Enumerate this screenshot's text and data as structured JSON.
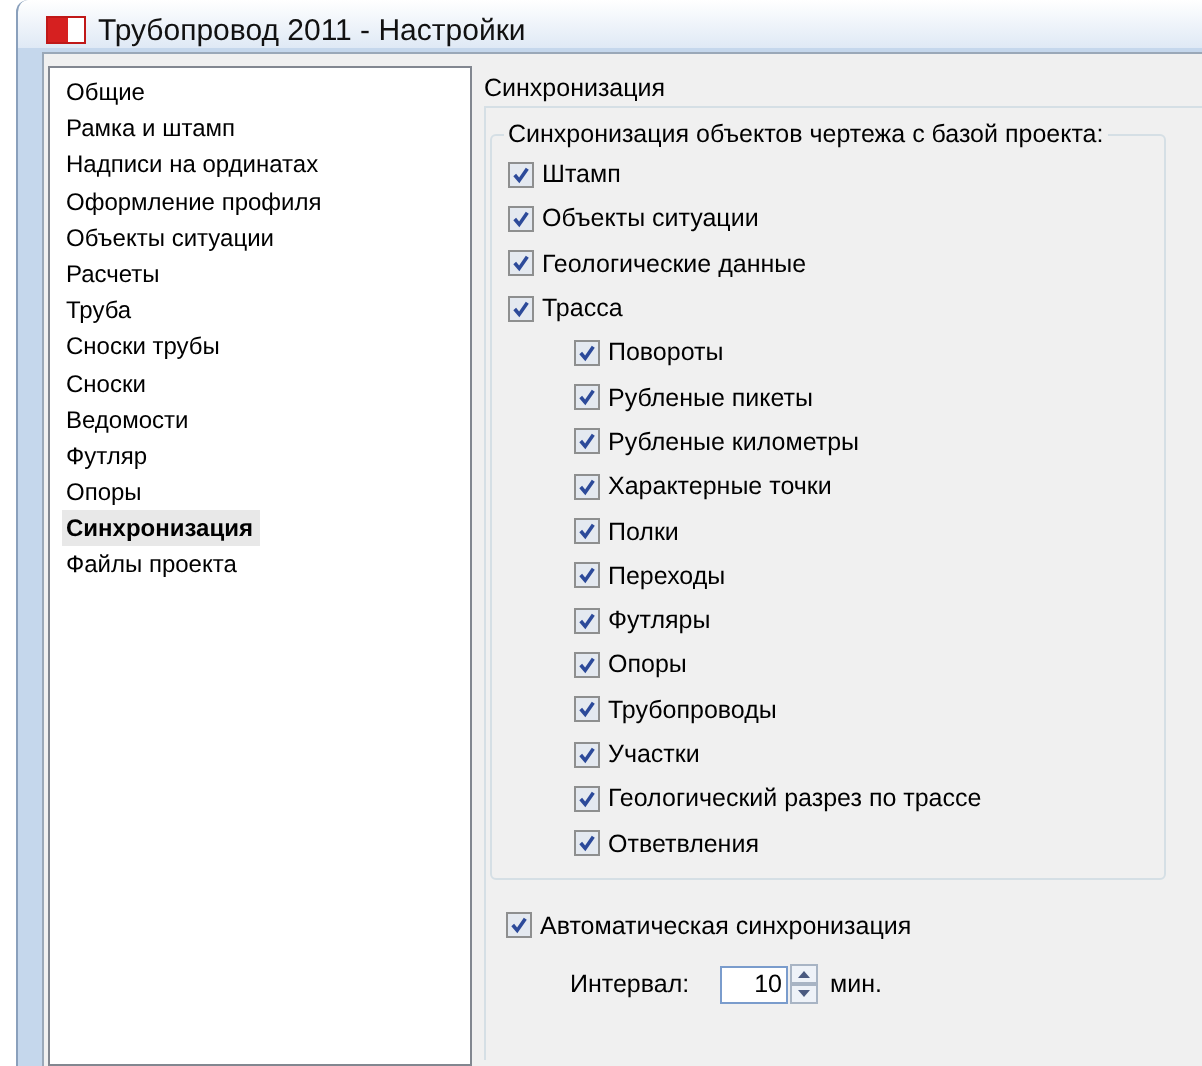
{
  "window": {
    "title": "Трубопровод 2011 - Настройки"
  },
  "sidebar": {
    "items": [
      {
        "label": "Общие",
        "selected": false
      },
      {
        "label": "Рамка и штамп",
        "selected": false
      },
      {
        "label": "Надписи на ординатах",
        "selected": false
      },
      {
        "label": "Оформление профиля",
        "selected": false
      },
      {
        "label": "Объекты ситуации",
        "selected": false
      },
      {
        "label": "Расчеты",
        "selected": false
      },
      {
        "label": "Труба",
        "selected": false
      },
      {
        "label": "Сноски трубы",
        "selected": false
      },
      {
        "label": "Сноски",
        "selected": false
      },
      {
        "label": "Ведомости",
        "selected": false
      },
      {
        "label": "Футляр",
        "selected": false
      },
      {
        "label": "Опоры",
        "selected": false
      },
      {
        "label": "Синхронизация",
        "selected": true
      },
      {
        "label": "Файлы проекта",
        "selected": false
      }
    ]
  },
  "panel": {
    "title": "Синхронизация",
    "group": {
      "title": "Синхронизация объектов чертежа с базой проекта:",
      "items": [
        {
          "label": "Штамп",
          "checked": true
        },
        {
          "label": "Объекты ситуации",
          "checked": true
        },
        {
          "label": "Геологические данные",
          "checked": true
        },
        {
          "label": "Трасса",
          "checked": true,
          "children": [
            {
              "label": "Повороты",
              "checked": true
            },
            {
              "label": "Рубленые пикеты",
              "checked": true
            },
            {
              "label": "Рубленые километры",
              "checked": true
            },
            {
              "label": "Характерные точки",
              "checked": true
            },
            {
              "label": "Полки",
              "checked": true
            },
            {
              "label": "Переходы",
              "checked": true
            },
            {
              "label": "Футляры",
              "checked": true
            },
            {
              "label": "Опоры",
              "checked": true
            },
            {
              "label": "Трубопроводы",
              "checked": true
            },
            {
              "label": "Участки",
              "checked": true
            },
            {
              "label": "Геологический разрез по трассе",
              "checked": true
            },
            {
              "label": "Ответвления",
              "checked": true
            }
          ]
        }
      ]
    },
    "auto_sync": {
      "label": "Автоматическая синхронизация",
      "checked": true
    },
    "interval": {
      "label": "Интервал:",
      "value": "10",
      "unit": "мин."
    }
  }
}
